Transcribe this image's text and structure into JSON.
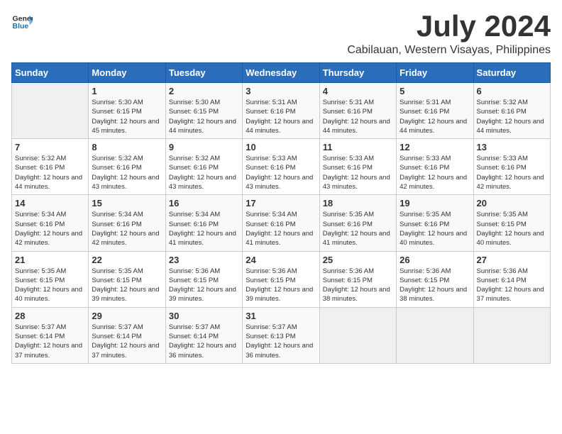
{
  "header": {
    "logo_general": "General",
    "logo_blue": "Blue",
    "month_year": "July 2024",
    "location": "Cabilauan, Western Visayas, Philippines"
  },
  "weekdays": [
    "Sunday",
    "Monday",
    "Tuesday",
    "Wednesday",
    "Thursday",
    "Friday",
    "Saturday"
  ],
  "weeks": [
    [
      {
        "day": "",
        "sunrise": "",
        "sunset": "",
        "daylight": ""
      },
      {
        "day": "1",
        "sunrise": "5:30 AM",
        "sunset": "6:15 PM",
        "daylight": "12 hours and 45 minutes."
      },
      {
        "day": "2",
        "sunrise": "5:30 AM",
        "sunset": "6:15 PM",
        "daylight": "12 hours and 44 minutes."
      },
      {
        "day": "3",
        "sunrise": "5:31 AM",
        "sunset": "6:16 PM",
        "daylight": "12 hours and 44 minutes."
      },
      {
        "day": "4",
        "sunrise": "5:31 AM",
        "sunset": "6:16 PM",
        "daylight": "12 hours and 44 minutes."
      },
      {
        "day": "5",
        "sunrise": "5:31 AM",
        "sunset": "6:16 PM",
        "daylight": "12 hours and 44 minutes."
      },
      {
        "day": "6",
        "sunrise": "5:32 AM",
        "sunset": "6:16 PM",
        "daylight": "12 hours and 44 minutes."
      }
    ],
    [
      {
        "day": "7",
        "sunrise": "5:32 AM",
        "sunset": "6:16 PM",
        "daylight": "12 hours and 44 minutes."
      },
      {
        "day": "8",
        "sunrise": "5:32 AM",
        "sunset": "6:16 PM",
        "daylight": "12 hours and 43 minutes."
      },
      {
        "day": "9",
        "sunrise": "5:32 AM",
        "sunset": "6:16 PM",
        "daylight": "12 hours and 43 minutes."
      },
      {
        "day": "10",
        "sunrise": "5:33 AM",
        "sunset": "6:16 PM",
        "daylight": "12 hours and 43 minutes."
      },
      {
        "day": "11",
        "sunrise": "5:33 AM",
        "sunset": "6:16 PM",
        "daylight": "12 hours and 43 minutes."
      },
      {
        "day": "12",
        "sunrise": "5:33 AM",
        "sunset": "6:16 PM",
        "daylight": "12 hours and 42 minutes."
      },
      {
        "day": "13",
        "sunrise": "5:33 AM",
        "sunset": "6:16 PM",
        "daylight": "12 hours and 42 minutes."
      }
    ],
    [
      {
        "day": "14",
        "sunrise": "5:34 AM",
        "sunset": "6:16 PM",
        "daylight": "12 hours and 42 minutes."
      },
      {
        "day": "15",
        "sunrise": "5:34 AM",
        "sunset": "6:16 PM",
        "daylight": "12 hours and 42 minutes."
      },
      {
        "day": "16",
        "sunrise": "5:34 AM",
        "sunset": "6:16 PM",
        "daylight": "12 hours and 41 minutes."
      },
      {
        "day": "17",
        "sunrise": "5:34 AM",
        "sunset": "6:16 PM",
        "daylight": "12 hours and 41 minutes."
      },
      {
        "day": "18",
        "sunrise": "5:35 AM",
        "sunset": "6:16 PM",
        "daylight": "12 hours and 41 minutes."
      },
      {
        "day": "19",
        "sunrise": "5:35 AM",
        "sunset": "6:16 PM",
        "daylight": "12 hours and 40 minutes."
      },
      {
        "day": "20",
        "sunrise": "5:35 AM",
        "sunset": "6:15 PM",
        "daylight": "12 hours and 40 minutes."
      }
    ],
    [
      {
        "day": "21",
        "sunrise": "5:35 AM",
        "sunset": "6:15 PM",
        "daylight": "12 hours and 40 minutes."
      },
      {
        "day": "22",
        "sunrise": "5:35 AM",
        "sunset": "6:15 PM",
        "daylight": "12 hours and 39 minutes."
      },
      {
        "day": "23",
        "sunrise": "5:36 AM",
        "sunset": "6:15 PM",
        "daylight": "12 hours and 39 minutes."
      },
      {
        "day": "24",
        "sunrise": "5:36 AM",
        "sunset": "6:15 PM",
        "daylight": "12 hours and 39 minutes."
      },
      {
        "day": "25",
        "sunrise": "5:36 AM",
        "sunset": "6:15 PM",
        "daylight": "12 hours and 38 minutes."
      },
      {
        "day": "26",
        "sunrise": "5:36 AM",
        "sunset": "6:15 PM",
        "daylight": "12 hours and 38 minutes."
      },
      {
        "day": "27",
        "sunrise": "5:36 AM",
        "sunset": "6:14 PM",
        "daylight": "12 hours and 37 minutes."
      }
    ],
    [
      {
        "day": "28",
        "sunrise": "5:37 AM",
        "sunset": "6:14 PM",
        "daylight": "12 hours and 37 minutes."
      },
      {
        "day": "29",
        "sunrise": "5:37 AM",
        "sunset": "6:14 PM",
        "daylight": "12 hours and 37 minutes."
      },
      {
        "day": "30",
        "sunrise": "5:37 AM",
        "sunset": "6:14 PM",
        "daylight": "12 hours and 36 minutes."
      },
      {
        "day": "31",
        "sunrise": "5:37 AM",
        "sunset": "6:13 PM",
        "daylight": "12 hours and 36 minutes."
      },
      {
        "day": "",
        "sunrise": "",
        "sunset": "",
        "daylight": ""
      },
      {
        "day": "",
        "sunrise": "",
        "sunset": "",
        "daylight": ""
      },
      {
        "day": "",
        "sunrise": "",
        "sunset": "",
        "daylight": ""
      }
    ]
  ]
}
